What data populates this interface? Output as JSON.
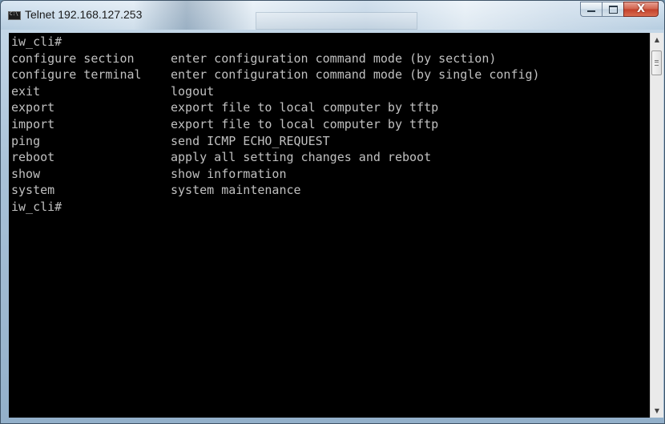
{
  "window": {
    "title": "Telnet 192.168.127.253",
    "icon": "console-icon",
    "controls": {
      "minimize_icon": "minimize-icon",
      "maximize_icon": "maximize-icon",
      "close_icon": "close-icon",
      "close_glyph": "X"
    }
  },
  "terminal": {
    "foreground": "#c0c0c0",
    "background": "#000000",
    "prompt_top": "iw_cli#",
    "commands": [
      {
        "cmd": "configure section",
        "desc": "enter configuration command mode (by section)"
      },
      {
        "cmd": "configure terminal",
        "desc": "enter configuration command mode (by single config)"
      },
      {
        "cmd": "exit",
        "desc": "logout"
      },
      {
        "cmd": "export",
        "desc": "export file to local computer by tftp"
      },
      {
        "cmd": "import",
        "desc": "export file to local computer by tftp"
      },
      {
        "cmd": "ping",
        "desc": "send ICMP ECHO_REQUEST"
      },
      {
        "cmd": "reboot",
        "desc": "apply all setting changes and reboot"
      },
      {
        "cmd": "show",
        "desc": "show information"
      },
      {
        "cmd": "system",
        "desc": "system maintenance"
      }
    ],
    "prompt_bottom": "iw_cli#"
  },
  "scrollbar": {
    "up_arrow": "▲",
    "down_arrow": "▼"
  }
}
